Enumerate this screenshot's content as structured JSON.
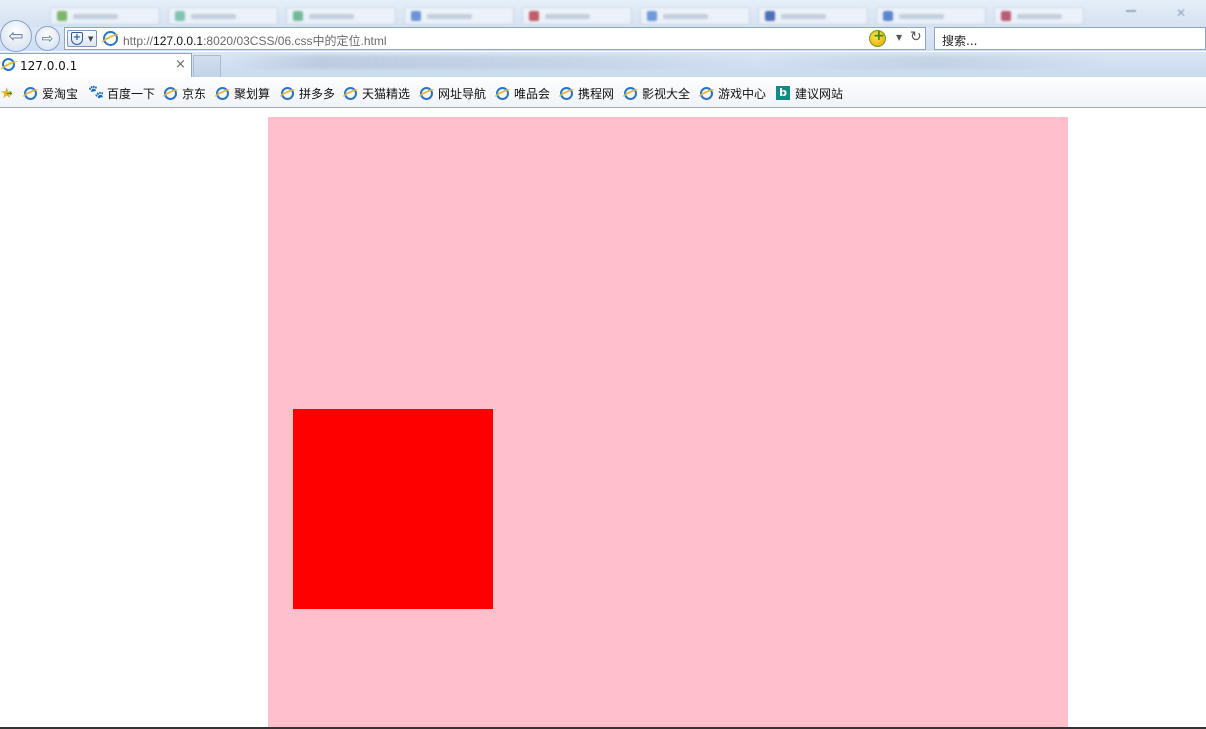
{
  "browser": {
    "address": {
      "url_prefix": "http://",
      "url_host": "127.0.0.1",
      "url_rest": ":8020/03CSS/06.css中的定位.html"
    },
    "search_placeholder": "搜索...",
    "active_tab": {
      "title": "127.0.0.1",
      "close_glyph": "×"
    }
  },
  "favorites": [
    {
      "label": "爱淘宝",
      "icon": "ie"
    },
    {
      "label": "百度一下",
      "icon": "paw"
    },
    {
      "label": "京东",
      "icon": "ie"
    },
    {
      "label": "聚划算",
      "icon": "ie"
    },
    {
      "label": "拼多多",
      "icon": "ie"
    },
    {
      "label": "天猫精选",
      "icon": "ie"
    },
    {
      "label": "网址导航",
      "icon": "ie"
    },
    {
      "label": "唯品会",
      "icon": "ie"
    },
    {
      "label": "携程网",
      "icon": "ie"
    },
    {
      "label": "影视大全",
      "icon": "ie"
    },
    {
      "label": "游戏中心",
      "icon": "ie"
    },
    {
      "label": "建议网站",
      "icon": "bing"
    }
  ],
  "colors": {
    "outer_box": "#ffc0cb",
    "inner_box": "#ff0000"
  }
}
